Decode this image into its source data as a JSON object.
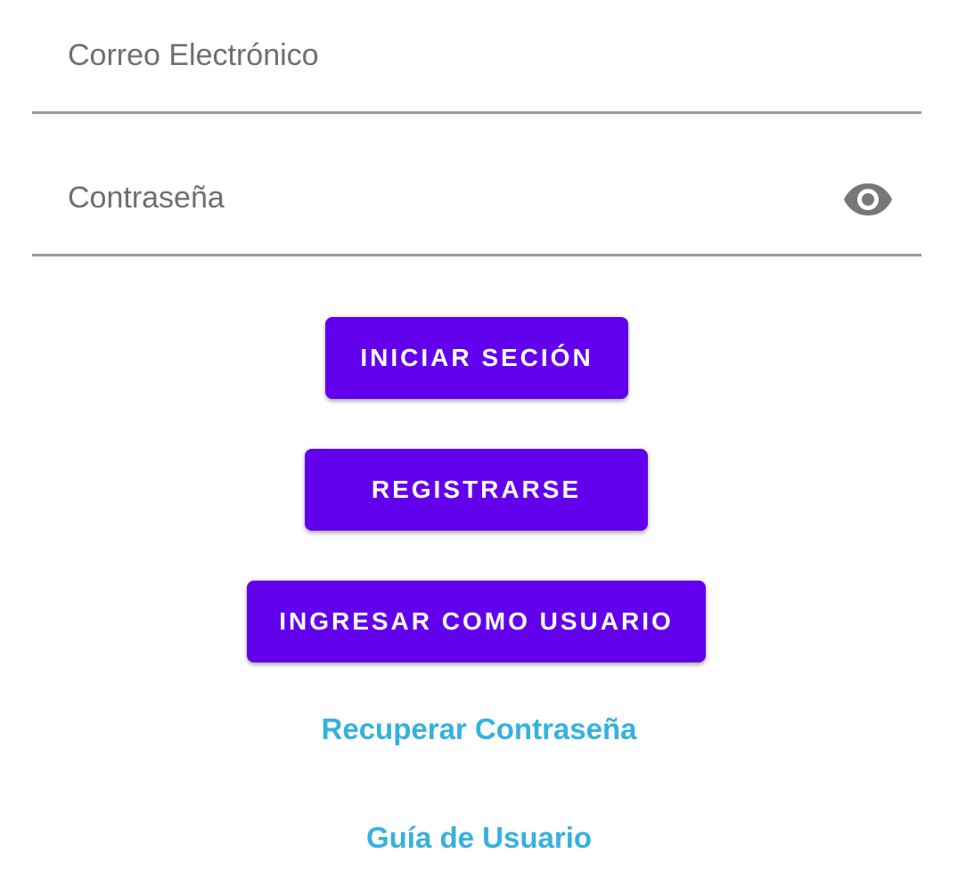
{
  "form": {
    "email": {
      "placeholder": "Correo Electrónico",
      "value": ""
    },
    "password": {
      "placeholder": "Contraseña",
      "value": "",
      "toggle_icon": "eye-icon"
    }
  },
  "buttons": {
    "login_label": "INICIAR SECIÓN",
    "register_label": "REGISTRARSE",
    "guest_label": "INGRESAR COMO USUARIO"
  },
  "links": {
    "recover_password": "Recuperar Contraseña",
    "user_guide": "Guía de Usuario"
  },
  "colors": {
    "button_background": "#6200ee",
    "button_text": "#ffffff",
    "link": "#36b1df",
    "placeholder": "#6f6f6f",
    "underline": "#9a9a9a",
    "icon": "#777777"
  }
}
